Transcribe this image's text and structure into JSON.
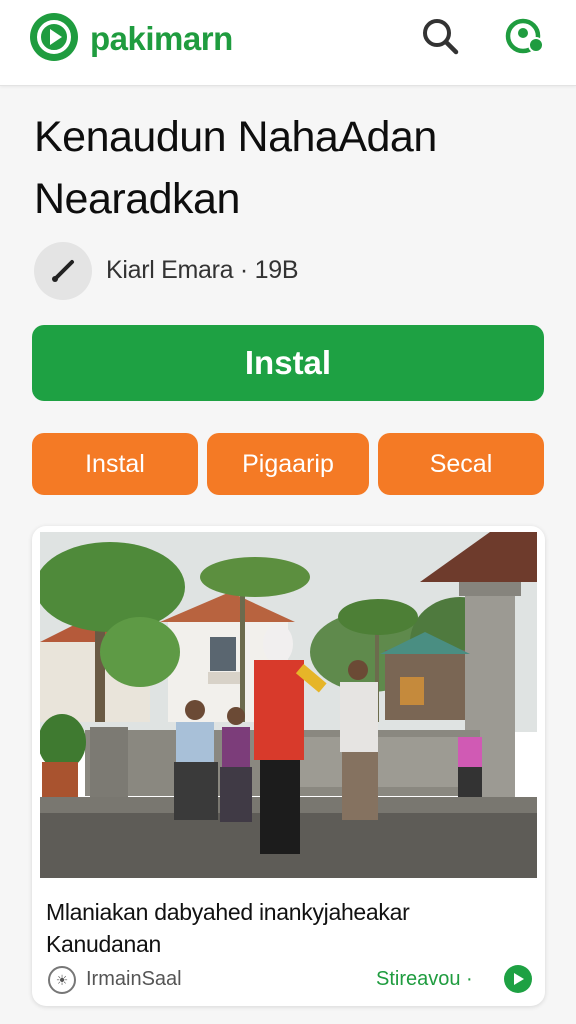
{
  "header": {
    "brand": "pakimarn",
    "logo_icon": "play-logo-icon",
    "search_icon": "search-icon",
    "profile_icon": "profile-icon",
    "accent_color": "#1f9c3f"
  },
  "app": {
    "title": "Kenaudun NahaAdan Nearadkan",
    "developer_icon": "brush-icon",
    "meta": "Kiarl Emara · 19B"
  },
  "actions": {
    "install_label": "Instal",
    "install_color": "#1ea143",
    "secondary": [
      "Instal",
      "Pigaarip",
      "Secal"
    ],
    "secondary_color": "#f47a25"
  },
  "card": {
    "image_subject": "photo of people standing in front of a building with palm trees",
    "caption": "Mlaniakan dabyahed inankyjaheakar Kanudanan",
    "source_icon": "source-icon",
    "source": "IrmainSaal",
    "action_label": "Stireavou ·",
    "action_icon": "share-icon"
  }
}
